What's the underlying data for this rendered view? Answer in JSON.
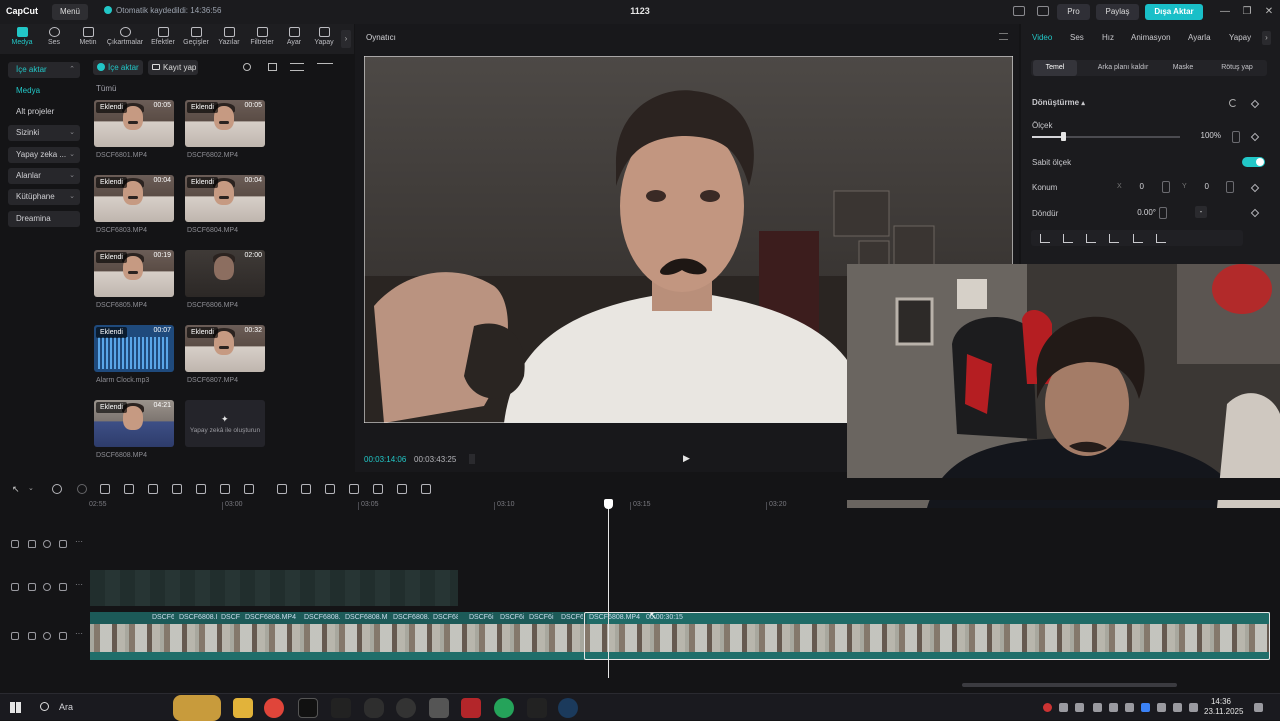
{
  "app": {
    "logo": "CapCut",
    "menu_label": "Menü",
    "autosave_text": "Otomatik kaydedildi: 14:36:56",
    "project_title": "1123",
    "pro_label": "Pro",
    "share_label": "Paylaş",
    "export_label": "Dışa Aktar",
    "accent_color": "#22c7c7"
  },
  "toolbar": {
    "items": [
      {
        "label": "Medya",
        "icon": "media-icon"
      },
      {
        "label": "Ses",
        "icon": "audio-icon"
      },
      {
        "label": "Metin",
        "icon": "text-icon"
      },
      {
        "label": "Çıkartmalar",
        "icon": "sticker-icon"
      },
      {
        "label": "Efektler",
        "icon": "effects-icon"
      },
      {
        "label": "Geçişler",
        "icon": "transitions-icon"
      },
      {
        "label": "Yazılar",
        "icon": "captions-icon"
      },
      {
        "label": "Filtreler",
        "icon": "filters-icon"
      },
      {
        "label": "Ayar",
        "icon": "adjust-icon"
      },
      {
        "label": "Yapay",
        "icon": "ai-icon"
      }
    ]
  },
  "sidebar": {
    "items": [
      {
        "label": "İçe aktar",
        "chev": "⌃"
      },
      {
        "label": "Medya",
        "chev": ""
      },
      {
        "label": "Alt projeler",
        "chev": ""
      },
      {
        "label": "Sizinki",
        "chev": "⌄"
      },
      {
        "label": "Yapay zeka ...",
        "chev": "⌄"
      },
      {
        "label": "Alanlar",
        "chev": "⌄"
      },
      {
        "label": "Kütüphane",
        "chev": "⌄"
      },
      {
        "label": "Dreamina",
        "chev": ""
      }
    ]
  },
  "media": {
    "import_label": "İçe aktar",
    "record_label": "Kayıt yap",
    "all_label": "Tümü",
    "added_badge": "Eklendi",
    "cards": [
      {
        "name": "DSCF6801.MP4",
        "duration": "00:05"
      },
      {
        "name": "DSCF6802.MP4",
        "duration": "00:05"
      },
      {
        "name": "DSCF6803.MP4",
        "duration": "00:04"
      },
      {
        "name": "DSCF6804.MP4",
        "duration": "00:04"
      },
      {
        "name": "DSCF6805.MP4",
        "duration": "00:19"
      },
      {
        "name": "DSCF6806.MP4",
        "duration": "02:00"
      },
      {
        "name": "Alarm Clock.mp3",
        "duration": "00:07"
      },
      {
        "name": "DSCF6807.MP4",
        "duration": "00:32"
      },
      {
        "name": "DSCF6808.MP4",
        "duration": "04:21"
      }
    ],
    "ai_create_text": "Yapay zekâ ile oluşturun"
  },
  "player": {
    "title": "Oynatıcı",
    "current_time": "00:03:14:06",
    "total_time": "00:03:43:25"
  },
  "right_panel": {
    "tabs": [
      "Video",
      "Ses",
      "Hız",
      "Animasyon",
      "Ayarla",
      "Yapay"
    ],
    "subtabs": [
      "Temel",
      "Arka planı kaldır",
      "Maske",
      "Rötuş yap"
    ],
    "transform_label": "Dönüştürme",
    "scale_label": "Ölçek",
    "scale_value": "100%",
    "scale_level": 0.21,
    "uniform_scale_label": "Sabit ölçek",
    "uniform_scale_on": true,
    "position_label": "Konum",
    "x_label": "X",
    "x_value": "0",
    "y_label": "Y",
    "y_value": "0",
    "rotate_label": "Döndür",
    "rotate_value": "0.00°",
    "rotate_dash": "-"
  },
  "timeline": {
    "ruler": [
      "02:55",
      "03:00",
      "03:05",
      "03:10",
      "03:15",
      "03:20"
    ],
    "clips": [
      {
        "label": "DSCF6"
      },
      {
        "label": "DSCF6808.I"
      },
      {
        "label": "DSCF"
      },
      {
        "label": "DSCF6808.MP4"
      },
      {
        "label": "DSCF6808.I"
      },
      {
        "label": "DSCF6808.MI"
      },
      {
        "label": "DSCF6808.I"
      },
      {
        "label": "DSCF68"
      },
      {
        "label": "DSCF6i"
      },
      {
        "label": "DSCF6i"
      },
      {
        "label": "DSCF6i"
      },
      {
        "label": "DSCF6i"
      }
    ],
    "selected_clip_label": "DSCF6808.MP4",
    "selected_clip_duration": "00:00:30:15"
  },
  "taskbar": {
    "search_label": "Ara",
    "time": "14:36",
    "date": "23.11.2025"
  }
}
